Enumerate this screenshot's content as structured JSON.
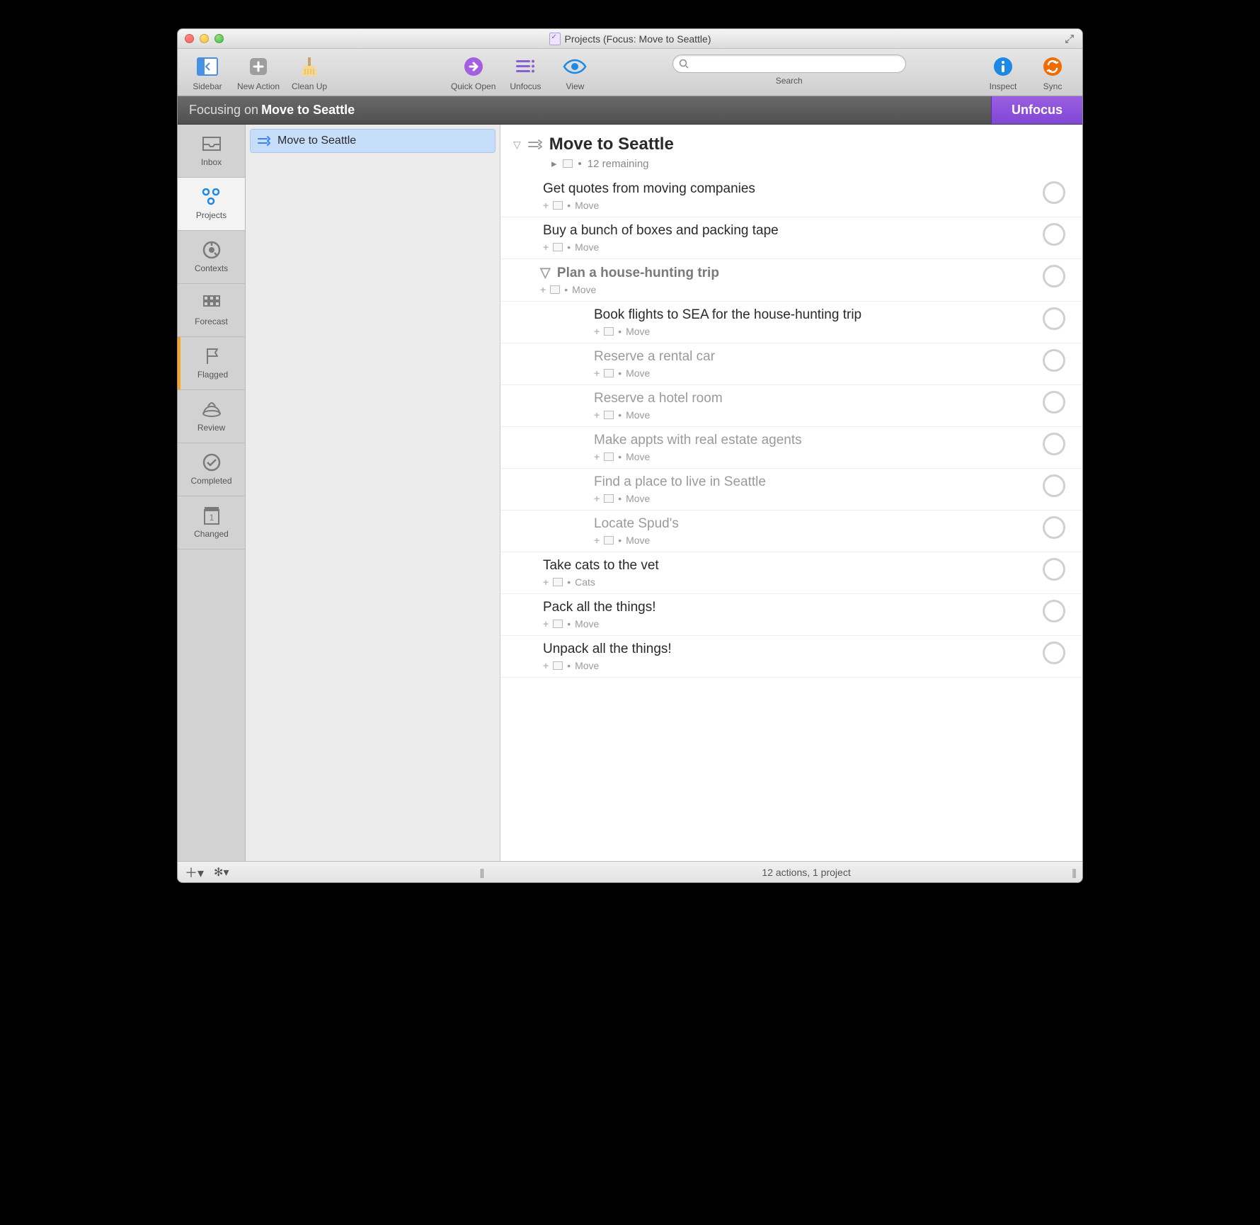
{
  "window": {
    "title": "Projects (Focus: Move to Seattle)"
  },
  "toolbar": {
    "sidebar": "Sidebar",
    "new_action": "New Action",
    "clean_up": "Clean Up",
    "quick_open": "Quick Open",
    "unfocus": "Unfocus",
    "view": "View",
    "search": "Search",
    "inspect": "Inspect",
    "sync": "Sync",
    "search_placeholder": ""
  },
  "focusbar": {
    "prefix": "Focusing on",
    "target": "Move to Seattle",
    "unfocus_label": "Unfocus"
  },
  "perspectives": [
    {
      "id": "inbox",
      "label": "Inbox"
    },
    {
      "id": "projects",
      "label": "Projects"
    },
    {
      "id": "contexts",
      "label": "Contexts"
    },
    {
      "id": "forecast",
      "label": "Forecast"
    },
    {
      "id": "flagged",
      "label": "Flagged"
    },
    {
      "id": "review",
      "label": "Review"
    },
    {
      "id": "completed",
      "label": "Completed"
    },
    {
      "id": "changed",
      "label": "Changed"
    }
  ],
  "sidebar": {
    "selected_project": "Move to Seattle"
  },
  "outline": {
    "project_title": "Move to Seattle",
    "remaining": "12 remaining",
    "tasks": [
      {
        "title": "Get quotes from moving companies",
        "context": "Move"
      },
      {
        "title": "Buy a bunch of boxes and packing tape",
        "context": "Move"
      },
      {
        "title": "Plan a house-hunting trip",
        "context": "Move",
        "header": true
      },
      {
        "title": "Book flights to SEA for the house-hunting trip",
        "context": "Move",
        "sub": true
      },
      {
        "title": "Reserve a rental car",
        "context": "Move",
        "sub": true,
        "dim": true
      },
      {
        "title": "Reserve a hotel room",
        "context": "Move",
        "sub": true,
        "dim": true
      },
      {
        "title": "Make appts with real estate agents",
        "context": "Move",
        "sub": true,
        "dim": true
      },
      {
        "title": "Find a place to live in Seattle",
        "context": "Move",
        "sub": true,
        "dim": true
      },
      {
        "title": "Locate Spud's",
        "context": "Move",
        "sub": true,
        "dim": true
      },
      {
        "title": "Take cats to the vet",
        "context": "Cats"
      },
      {
        "title": "Pack all the things!",
        "context": "Move"
      },
      {
        "title": "Unpack all the things!",
        "context": "Move"
      }
    ]
  },
  "statusbar": {
    "summary": "12 actions, 1 project"
  }
}
